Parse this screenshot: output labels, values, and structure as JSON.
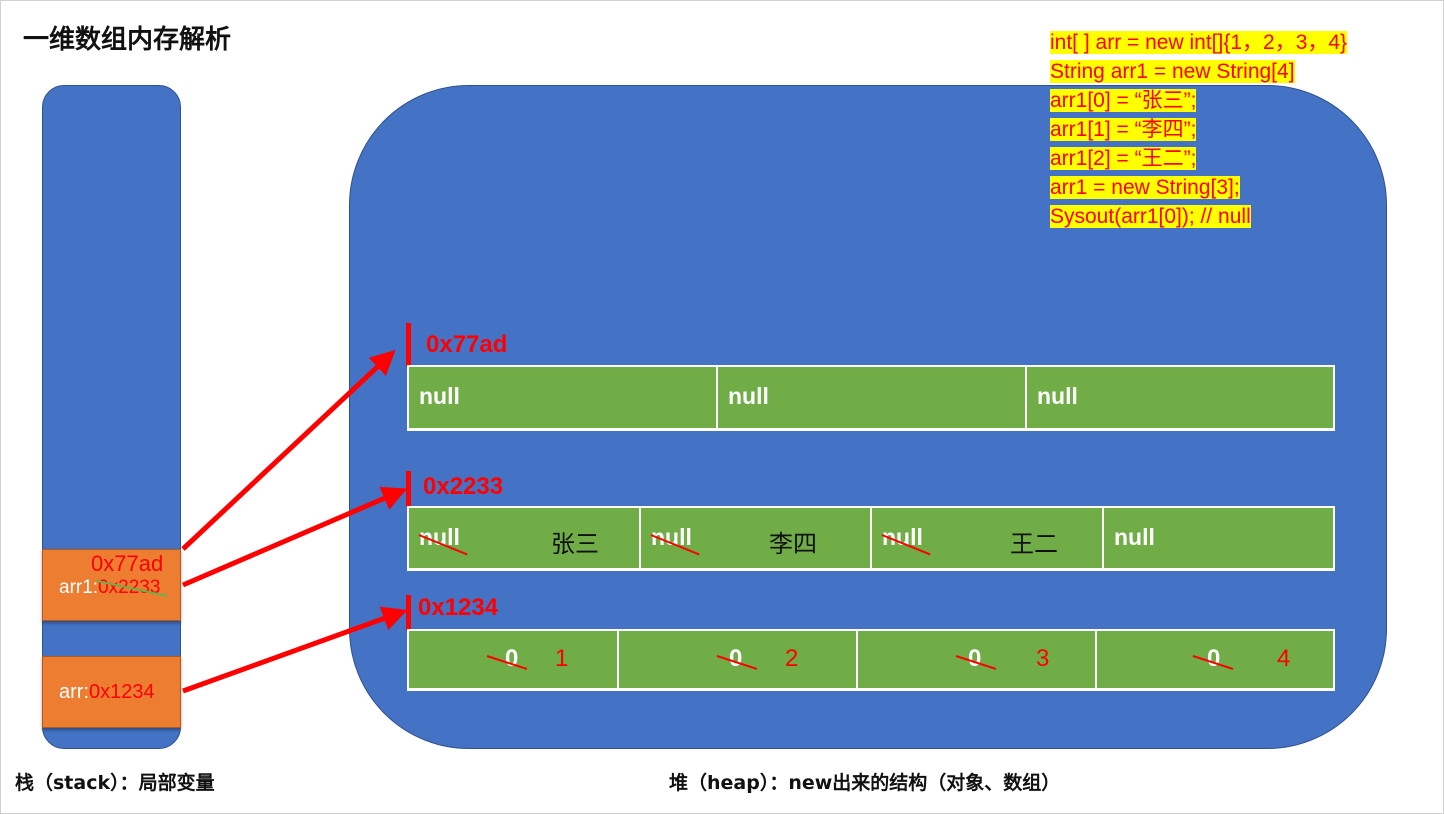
{
  "title": "一维数组内存解析",
  "code": [
    "int[ ] arr = new int[]{1，2，3，4}",
    "String arr1 = new String[4]",
    "arr1[0] = “张三”;",
    "arr1[1] = “李四”;",
    "arr1[2] = “王二”;",
    "arr1 = new String[3];",
    "Sysout(arr1[0]);  // null"
  ],
  "stack": {
    "caption": "栈（stack）：局部变量",
    "arr1": {
      "name": "arr1:",
      "old_addr": "0x2233",
      "new_addr": "0x77ad"
    },
    "arr": {
      "name": "arr:",
      "addr": "0x1234"
    }
  },
  "heap": {
    "caption": "堆（heap）：new出来的结构（对象、数组）",
    "array_77ad": {
      "addr": "0x77ad",
      "cells": [
        "null",
        "null",
        "null"
      ]
    },
    "array_2233": {
      "addr": "0x2233",
      "cells": [
        {
          "old": "null",
          "new": "张三"
        },
        {
          "old": "null",
          "new": "李四"
        },
        {
          "old": "null",
          "new": "王二"
        },
        {
          "old": "",
          "new": "null"
        }
      ]
    },
    "array_1234": {
      "addr": "0x1234",
      "cells": [
        {
          "old": "0",
          "new": "1"
        },
        {
          "old": "0",
          "new": "2"
        },
        {
          "old": "0",
          "new": "3"
        },
        {
          "old": "0",
          "new": "4"
        }
      ]
    }
  },
  "colors": {
    "region_blue": "#4472c4",
    "frame_orange": "#ed7d31",
    "cell_green": "#70ad47",
    "pointer_red": "#ff0000",
    "highlight_yellow": "#ffff00"
  }
}
